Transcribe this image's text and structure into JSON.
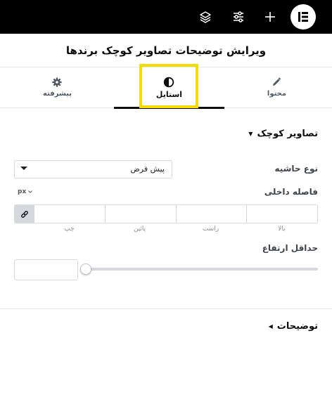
{
  "header": {
    "logo_icon": "elementor-logo-icon",
    "icons": [
      "plus-icon",
      "sliders-icon",
      "layers-icon"
    ]
  },
  "panel": {
    "title": "ویرایش توضیحات تصاویر کوچک برندها"
  },
  "tabs": [
    {
      "label": "محتوا",
      "icon": "pencil-icon"
    },
    {
      "label": "استایل",
      "icon": "contrast-icon",
      "active": true
    },
    {
      "label": "پیشرفته",
      "icon": "gear-icon"
    }
  ],
  "section": {
    "title": "تصاویر کوچک",
    "border_type": {
      "label": "نوع حاشیه",
      "value": "پیش فرض"
    },
    "padding": {
      "label": "فاصله داخلی",
      "unit": "px",
      "fields": [
        "بالا",
        "راست",
        "پائین",
        "چپ"
      ]
    },
    "min_height": {
      "label": "حداقل ارتفاع",
      "value": ""
    }
  },
  "section2": {
    "title": "توضیحات"
  },
  "colors": {
    "highlight": "#f5dc00",
    "topbar": "#000000"
  }
}
